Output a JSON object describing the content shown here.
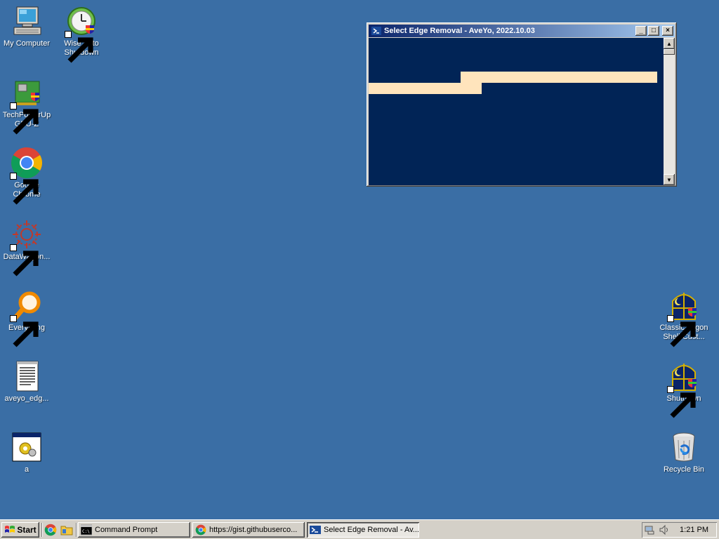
{
  "desktop": {
    "background": "#3a6ea5",
    "icons": [
      {
        "label": "My Computer",
        "icon": "computer-icon"
      },
      {
        "label": "Wise Auto Shutdown",
        "icon": "wise-auto-shutdown-icon"
      },
      {
        "label": "TechPowerUp GPU-Z",
        "icon": "gpu-z-icon"
      },
      {
        "label": "Google Chrome",
        "icon": "chrome-icon"
      },
      {
        "label": "DataWagon...",
        "icon": "datawagon-icon"
      },
      {
        "label": "Everything",
        "icon": "everything-search-icon"
      },
      {
        "label": "aveyo_edg...",
        "icon": "text-document-icon"
      },
      {
        "label": "a",
        "icon": "batch-file-icon"
      },
      {
        "label": "Classic Logon Shell Cust...",
        "icon": "classic-logon-icon"
      },
      {
        "label": "Shutdown",
        "icon": "shutdown-icon"
      },
      {
        "label": "Recycle Bin",
        "icon": "recycle-bin-icon"
      }
    ]
  },
  "console_window": {
    "title": "Select Edge Removal - AveYo, 2022.10.03",
    "background": "#012456",
    "highlight": "#ffe4bc",
    "buttons": {
      "minimize": "_",
      "maximize": "□",
      "close": "×"
    }
  },
  "taskbar": {
    "start_label": "Start",
    "quick_launch": [
      "chrome-icon",
      "explorer-folder-icon"
    ],
    "tasks": [
      {
        "label": "Command Prompt",
        "icon": "cmd-icon",
        "active": false
      },
      {
        "label": "https://gist.githubuserco...",
        "icon": "chrome-icon",
        "active": false
      },
      {
        "label": "Select Edge Removal - Av...",
        "icon": "powershell-icon",
        "active": true
      }
    ],
    "tray": {
      "icons": [
        "network-icon",
        "volume-icon"
      ],
      "clock": "1:21 PM"
    }
  }
}
